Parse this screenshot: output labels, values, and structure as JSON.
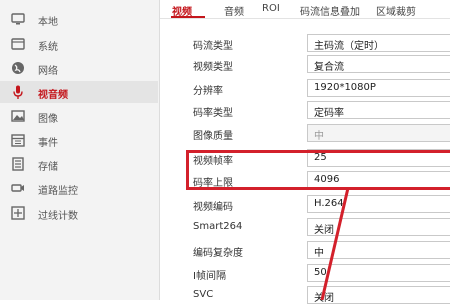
{
  "sidebar": {
    "items": [
      {
        "label": "本地",
        "icon": "monitor-icon"
      },
      {
        "label": "系统",
        "icon": "system-icon"
      },
      {
        "label": "网络",
        "icon": "globe-icon"
      },
      {
        "label": "视音频",
        "icon": "microphone-icon",
        "active": true
      },
      {
        "label": "图像",
        "icon": "image-icon"
      },
      {
        "label": "事件",
        "icon": "calendar-icon"
      },
      {
        "label": "存储",
        "icon": "storage-icon"
      },
      {
        "label": "道路监控",
        "icon": "road-camera-icon"
      },
      {
        "label": "过线计数",
        "icon": "counter-icon"
      }
    ]
  },
  "tabs": [
    "视频",
    "音频",
    "ROI",
    "码流信息叠加",
    "区域裁剪"
  ],
  "settings": [
    {
      "label": "码流类型",
      "value": "主码流（定时）"
    },
    {
      "label": "视频类型",
      "value": "复合流"
    },
    {
      "label": "分辨率",
      "value": "1920*1080P"
    },
    {
      "label": "码率类型",
      "value": "定码率"
    },
    {
      "label": "图像质量",
      "value": "中",
      "disabled": true
    },
    {
      "label": "视频帧率",
      "value": "25"
    },
    {
      "label": "码率上限",
      "value": "4096"
    },
    {
      "label": "视频编码",
      "value": "H.264"
    },
    {
      "label": "Smart264",
      "value": "关闭"
    },
    {
      "label": "编码复杂度",
      "value": "中"
    },
    {
      "label": "I帧间隔",
      "value": "50"
    },
    {
      "label": "SVC",
      "value": "关闭"
    }
  ],
  "colors": {
    "accent": "#c4161c",
    "highlight": "#d3202b"
  }
}
